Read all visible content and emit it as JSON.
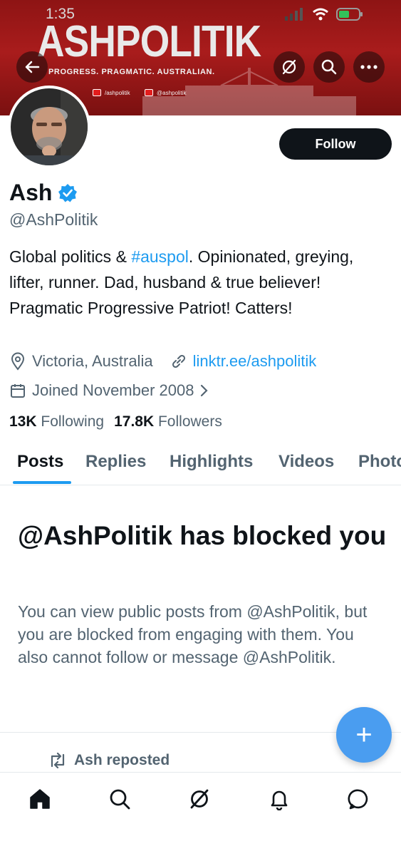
{
  "status_bar": {
    "time": "1:35"
  },
  "banner": {
    "title": "ASHPOLITIK",
    "tagline": "PROGRESS. PRAGMATIC. AUSTRALIAN.",
    "youtube_handle": "/ashpolitik",
    "instagram_handle": "@ashpolitik"
  },
  "header_actions": {
    "back_icon": "back-arrow-icon",
    "grok_icon": "grok-icon",
    "search_icon": "search-icon",
    "more_icon": "more-icon"
  },
  "profile": {
    "follow_label": "Follow",
    "name": "Ash",
    "handle": "@AshPolitik",
    "bio_before": "Global politics & ",
    "bio_hashtag": "#auspol",
    "bio_after": ". Opinionated, greying, lifter, runner. Dad, husband & true believer! Pragmatic Progressive Patriot! Catters!",
    "location": "Victoria, Australia",
    "website": "linktr.ee/ashpolitik",
    "joined": "Joined November 2008",
    "following_count": "13K",
    "following_label": "Following",
    "followers_count": "17.8K",
    "followers_label": "Followers"
  },
  "tabs": [
    "Posts",
    "Replies",
    "Highlights",
    "Videos",
    "Photos"
  ],
  "blocked": {
    "title": "@AshPolitik has blocked you",
    "description": "You can view public posts from @AshPolitik, but you are blocked from engaging with them. You also cannot follow or message @AshPolitik."
  },
  "repost_label": "Ash reposted",
  "fab_label": "+",
  "colors": {
    "accent": "#1d9bf0",
    "banner_red": "#a91c1c",
    "fab": "#4a9df0"
  }
}
